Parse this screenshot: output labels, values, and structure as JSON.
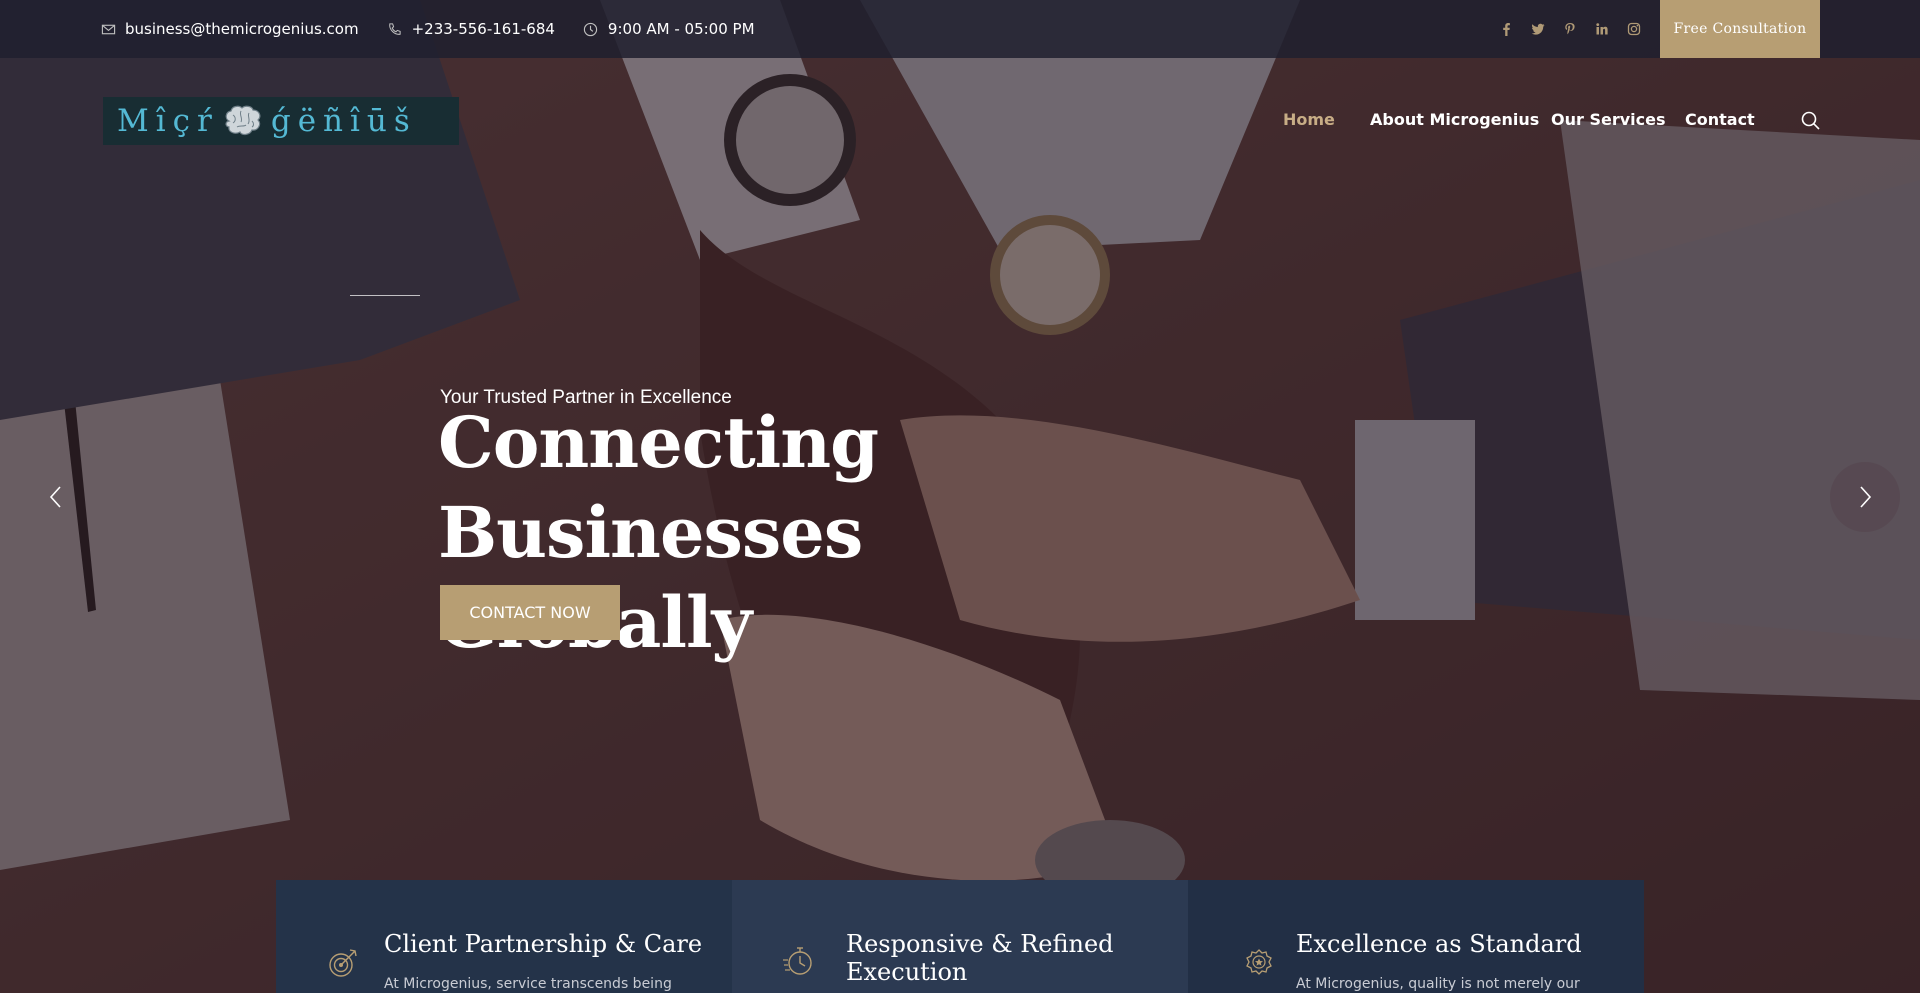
{
  "topbar": {
    "email": "business@themicrogenius.com",
    "phone": "+233-556-161-684",
    "hours": "9:00 AM - 05:00 PM",
    "email_icon": "envelope-icon",
    "phone_icon": "phone-icon",
    "hours_icon": "clock-icon",
    "social": [
      "facebook-icon",
      "twitter-icon",
      "pinterest-icon",
      "linkedin-icon",
      "instagram-icon"
    ],
    "cta_label": "Free Consultation"
  },
  "header": {
    "logo_left": "Mîçŕ",
    "logo_right": "ǵëñîūš",
    "logo_icon": "brain-icon",
    "nav": [
      {
        "label": "Home",
        "active": true
      },
      {
        "label": "About Microgenius",
        "active": false
      },
      {
        "label": "Our Services",
        "active": false
      },
      {
        "label": "Contact",
        "active": false
      }
    ],
    "search_icon": "search-icon"
  },
  "hero": {
    "subtitle": "Your Trusted Partner in Excellence",
    "title_line1": "Connecting",
    "title_line2": "Businesses Globally",
    "cta_label": "CONTACT NOW",
    "prev_icon": "chevron-left-icon",
    "next_icon": "chevron-right-icon"
  },
  "features": [
    {
      "icon": "target-icon",
      "title": "Client Partnership & Care",
      "text": "At Microgenius, service transcends being"
    },
    {
      "icon": "stopwatch-icon",
      "title_line1": "Responsive & Refined",
      "title_line2": "Execution",
      "text": ""
    },
    {
      "icon": "quality-badge-icon",
      "title": "Excellence as Standard",
      "text": "At Microgenius, quality is not merely our"
    }
  ],
  "colors": {
    "accent": "#b79e73",
    "nav_active": "#c8ad86",
    "topbar": "#20202e",
    "card_dark": "#243349"
  }
}
